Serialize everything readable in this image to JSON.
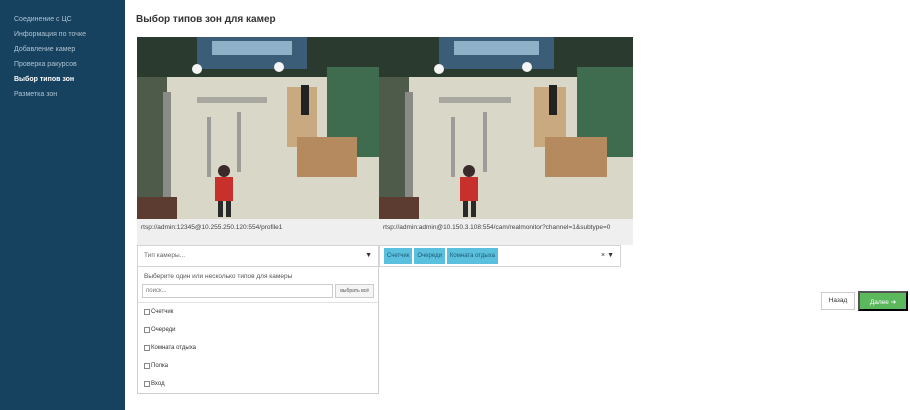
{
  "sidebar": {
    "items": [
      {
        "label": "Соединение с ЦС",
        "active": false
      },
      {
        "label": "Информация по точке",
        "active": false
      },
      {
        "label": "Добавление камер",
        "active": false
      },
      {
        "label": "Проверка ракурсов",
        "active": false
      },
      {
        "label": "Выбор типов зон",
        "active": true
      },
      {
        "label": "Разметка зон",
        "active": false
      }
    ]
  },
  "main": {
    "title": "Выбор типов зон для камер",
    "cameras": [
      {
        "url": "rtsp://admin:12345@10.255.250.120:554/profile1",
        "zone_select": {
          "placeholder": "Тип камеры...",
          "dropdown": {
            "hint": "Выберите один или несколько типов для камеры",
            "search_placeholder": "поиск...",
            "select_all_label": "выбрать всё",
            "options": [
              "Счетчик",
              "Очереди",
              "Комната отдыха",
              "Полка",
              "Вход"
            ]
          }
        }
      },
      {
        "url": "rtsp://admin:admin@10.150.3.108:554/cam/realmonitor?channel=1&subtype=0",
        "selected_zones": [
          "Счетчик",
          "Очереди",
          "Комната отдыха"
        ],
        "clear_symbol": "×",
        "caret_symbol": "▼"
      }
    ]
  },
  "footer": {
    "back_label": "Назад",
    "next_label": "Далее ➔"
  },
  "colors": {
    "sidebar_bg": "#16415f",
    "tag_bg": "#5bc0de",
    "next_btn": "#5cb85c"
  }
}
